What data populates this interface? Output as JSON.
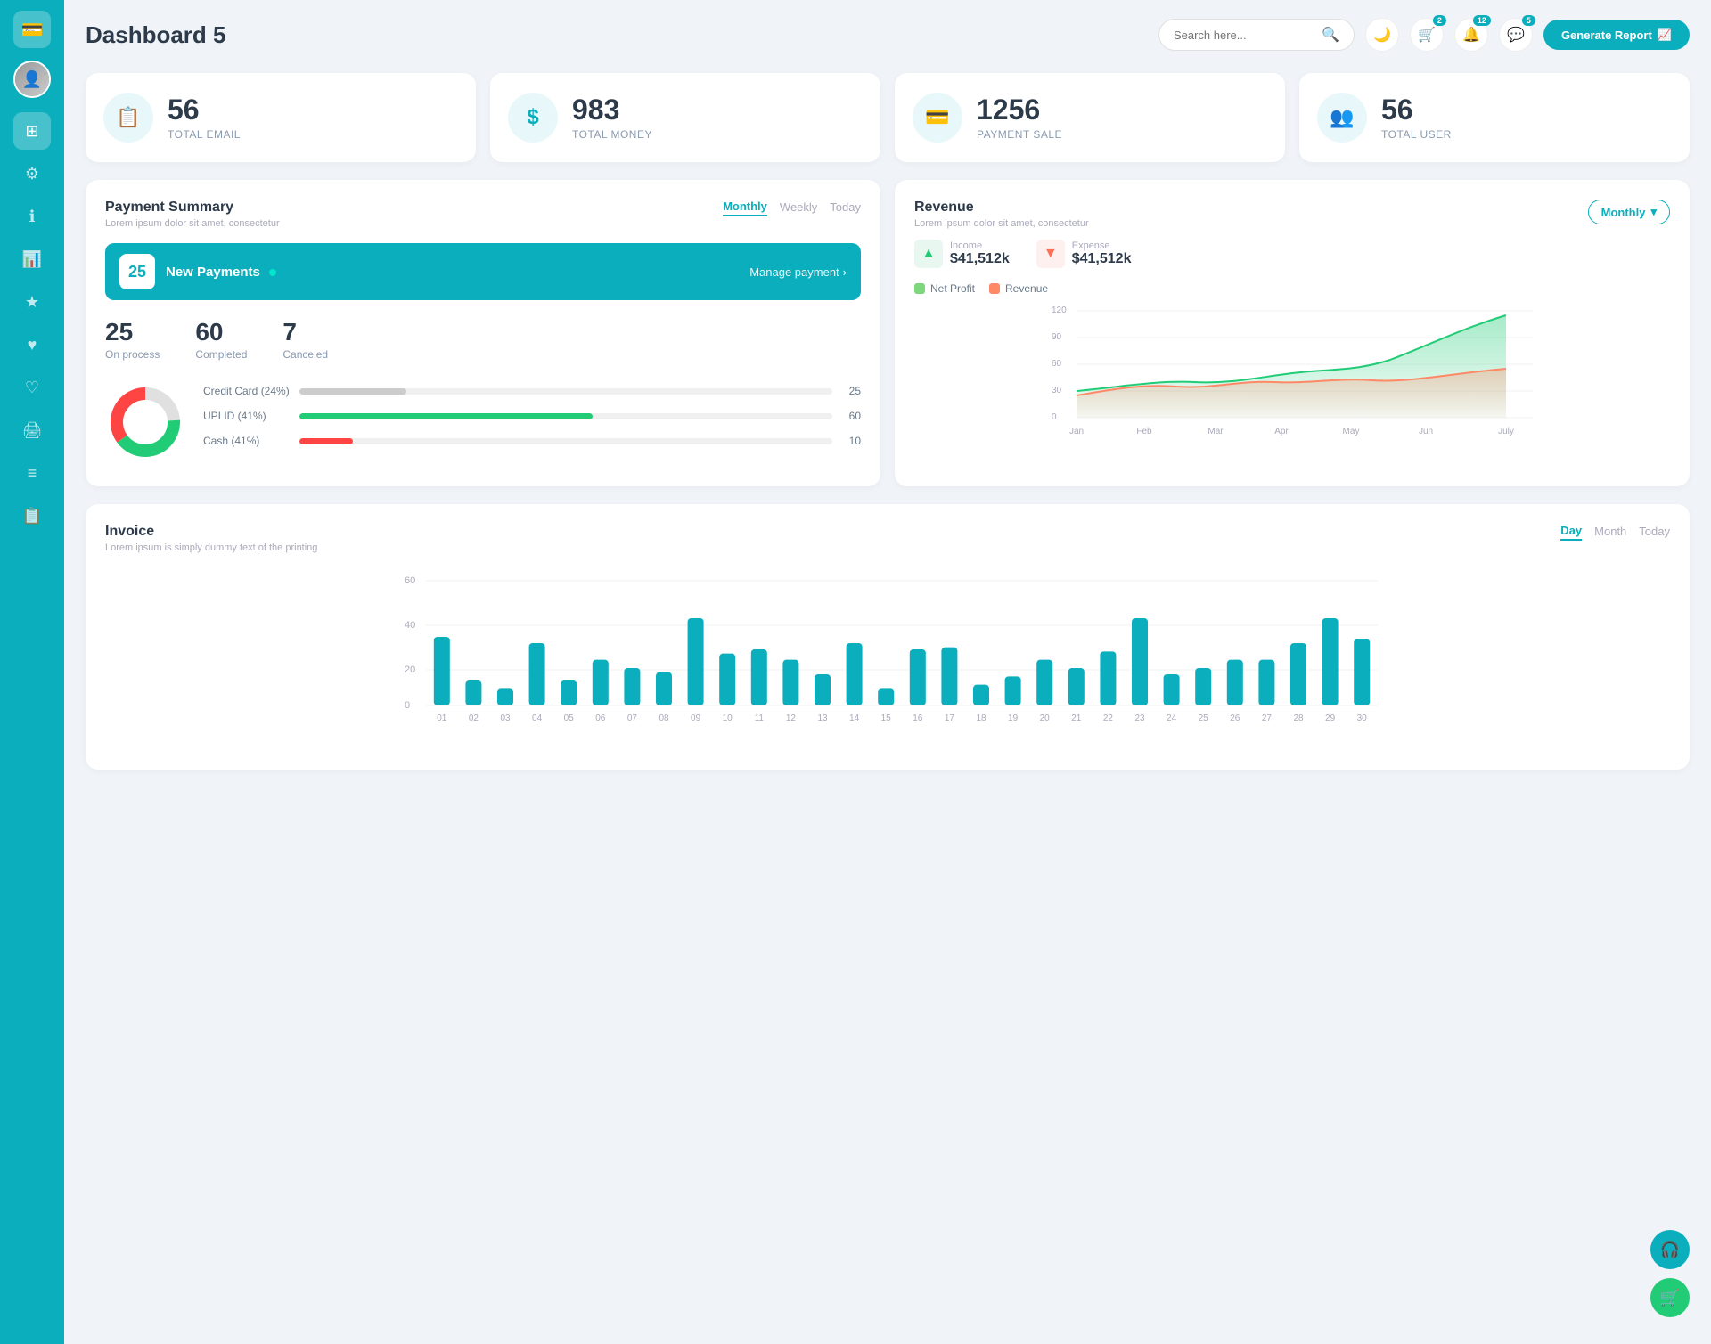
{
  "sidebar": {
    "logo_icon": "💳",
    "items": [
      {
        "id": "dashboard",
        "icon": "⊞",
        "active": true
      },
      {
        "id": "settings",
        "icon": "⚙"
      },
      {
        "id": "info",
        "icon": "ℹ"
      },
      {
        "id": "chart",
        "icon": "📊"
      },
      {
        "id": "star",
        "icon": "★"
      },
      {
        "id": "heart1",
        "icon": "♥"
      },
      {
        "id": "heart2",
        "icon": "♡"
      },
      {
        "id": "print",
        "icon": "🖨"
      },
      {
        "id": "menu",
        "icon": "≡"
      },
      {
        "id": "docs",
        "icon": "📋"
      }
    ]
  },
  "header": {
    "title": "Dashboard 5",
    "search_placeholder": "Search here...",
    "badges": {
      "notification1": "2",
      "notification2": "12",
      "notification3": "5"
    },
    "generate_btn": "Generate Report"
  },
  "stats": [
    {
      "id": "email",
      "number": "56",
      "label": "TOTAL EMAIL",
      "icon": "📋"
    },
    {
      "id": "money",
      "number": "983",
      "label": "TOTAL MONEY",
      "icon": "$"
    },
    {
      "id": "payment",
      "number": "1256",
      "label": "PAYMENT SALE",
      "icon": "💳"
    },
    {
      "id": "user",
      "number": "56",
      "label": "TOTAL USER",
      "icon": "👥"
    }
  ],
  "payment_summary": {
    "title": "Payment Summary",
    "subtitle": "Lorem ipsum dolor sit amet, consectetur",
    "tabs": [
      "Monthly",
      "Weekly",
      "Today"
    ],
    "active_tab": "Monthly",
    "new_payments": {
      "count": "25",
      "label": "New Payments",
      "manage_link": "Manage payment"
    },
    "stats": [
      {
        "number": "25",
        "label": "On process"
      },
      {
        "number": "60",
        "label": "Completed"
      },
      {
        "number": "7",
        "label": "Canceled"
      }
    ],
    "donut": {
      "segments": [
        {
          "color": "#e0e0e0",
          "value": 24,
          "label": "Credit Card"
        },
        {
          "color": "#22cc77",
          "value": 41,
          "label": "UPI ID"
        },
        {
          "color": "#ff4444",
          "value": 35,
          "label": "Cash"
        }
      ]
    },
    "progress_bars": [
      {
        "label": "Credit Card (24%)",
        "value": 25,
        "color": "#cccccc",
        "percent": 20
      },
      {
        "label": "UPI ID (41%)",
        "value": 60,
        "color": "#22cc77",
        "percent": 55
      },
      {
        "label": "Cash (41%)",
        "value": 10,
        "color": "#ff4444",
        "percent": 10
      }
    ]
  },
  "revenue": {
    "title": "Revenue",
    "subtitle": "Lorem ipsum dolor sit amet, consectetur",
    "dropdown": "Monthly",
    "income": {
      "label": "Income",
      "value": "$41,512k"
    },
    "expense": {
      "label": "Expense",
      "value": "$41,512k"
    },
    "legend": [
      {
        "label": "Net Profit",
        "color": "#7dd87d"
      },
      {
        "label": "Revenue",
        "color": "#ff8866"
      }
    ],
    "x_labels": [
      "Jan",
      "Feb",
      "Mar",
      "Apr",
      "May",
      "Jun",
      "July"
    ],
    "y_labels": [
      "120",
      "90",
      "60",
      "30",
      "0"
    ]
  },
  "invoice": {
    "title": "Invoice",
    "subtitle": "Lorem ipsum is simply dummy text of the printing",
    "tabs": [
      "Day",
      "Month",
      "Today"
    ],
    "active_tab": "Day",
    "y_labels": [
      "60",
      "40",
      "20",
      "0"
    ],
    "x_labels": [
      "01",
      "02",
      "03",
      "04",
      "05",
      "06",
      "07",
      "08",
      "09",
      "10",
      "11",
      "12",
      "13",
      "14",
      "15",
      "16",
      "17",
      "18",
      "19",
      "20",
      "21",
      "22",
      "23",
      "24",
      "25",
      "26",
      "27",
      "28",
      "29",
      "30"
    ],
    "bar_color": "#0aaebc",
    "bars": [
      33,
      12,
      8,
      30,
      12,
      22,
      18,
      16,
      42,
      25,
      27,
      22,
      15,
      30,
      8,
      27,
      28,
      10,
      14,
      22,
      18,
      26,
      42,
      15,
      18,
      22,
      22,
      30,
      42,
      32
    ]
  },
  "colors": {
    "primary": "#0aaebc",
    "secondary": "#22cc77",
    "accent": "#ff4444",
    "bg": "#f0f4f8"
  }
}
